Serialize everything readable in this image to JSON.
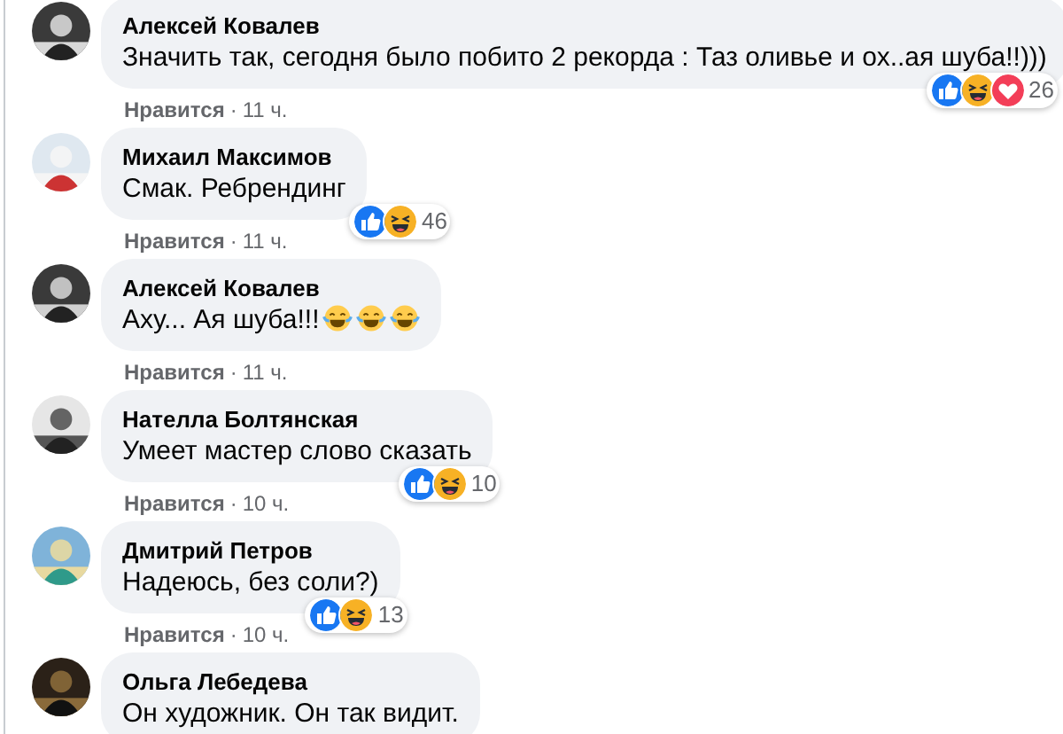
{
  "comments": [
    {
      "author": "Алексей Ковалев",
      "text": "Значить так, сегодня было побито 2 рекорда : Таз оливье и ох..ая шуба!!)))",
      "reactions": [
        {
          "kind": "like"
        },
        {
          "kind": "haha"
        },
        {
          "kind": "love"
        }
      ],
      "reaction_count": "26",
      "like_label": "Нравится",
      "separator": "·",
      "time": "11 ч."
    },
    {
      "author": "Михаил Максимов",
      "text": "Смак. Ребрендинг",
      "reactions": [
        {
          "kind": "like"
        },
        {
          "kind": "haha"
        }
      ],
      "reaction_count": "46",
      "like_label": "Нравится",
      "separator": "·",
      "time": "11 ч."
    },
    {
      "author": "Алексей Ковалев",
      "text": "Аху... Ая шуба!!!",
      "emoji": [
        {
          "kind": "tears-of-joy"
        },
        {
          "kind": "tears-of-joy"
        },
        {
          "kind": "tears-of-joy"
        }
      ],
      "like_label": "Нравится",
      "separator": "·",
      "time": "11 ч."
    },
    {
      "author": "Нателла Болтянская",
      "text": "Умеет мастер слово сказать",
      "reactions": [
        {
          "kind": "like"
        },
        {
          "kind": "haha"
        }
      ],
      "reaction_count": "10",
      "like_label": "Нравится",
      "separator": "·",
      "time": "10 ч."
    },
    {
      "author": "Дмитрий Петров",
      "text": "Надеюсь, без соли?)",
      "reactions": [
        {
          "kind": "like"
        },
        {
          "kind": "haha"
        }
      ],
      "reaction_count": "13",
      "like_label": "Нравится",
      "separator": "·",
      "time": "10 ч."
    },
    {
      "author": "Ольга Лебедева",
      "text": "Он художник. Он так видит."
    }
  ]
}
